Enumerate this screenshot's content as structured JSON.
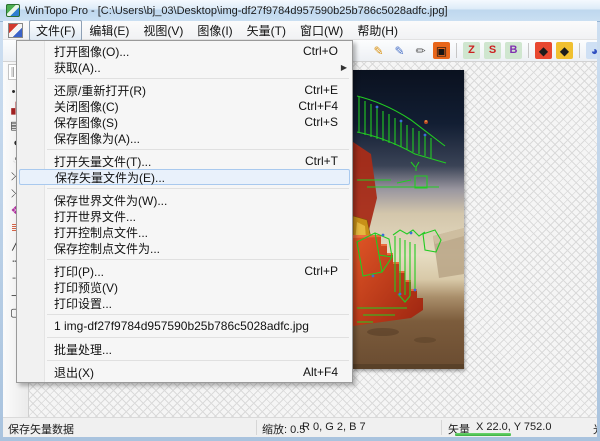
{
  "window": {
    "title": "WinTopo Pro - [C:\\Users\\bj_03\\Desktop\\img-df27f9784d957590b25b786c5028adfc.jpg]"
  },
  "colors": {
    "highlight_bg": "#e9f1fb",
    "highlight_border": "#a9c9ee",
    "vector_green": "#22cc22",
    "progress_green": "#3cb043",
    "stairs_red": "#c53a1c"
  },
  "menubar": {
    "items": [
      {
        "name": "file",
        "label": "文件(F)",
        "active": true
      },
      {
        "name": "edit",
        "label": "编辑(E)"
      },
      {
        "name": "view",
        "label": "视图(V)"
      },
      {
        "name": "image",
        "label": "图像(I)"
      },
      {
        "name": "vector",
        "label": "矢量(T)"
      },
      {
        "name": "window",
        "label": "窗口(W)"
      },
      {
        "name": "help",
        "label": "帮助(H)"
      }
    ]
  },
  "toolbar": {
    "items": [
      {
        "name": "pencil",
        "glyph": "✎",
        "fg": "#d89010"
      },
      {
        "name": "pencil-edit",
        "glyph": "✎",
        "fg": "#4a72c8"
      },
      {
        "name": "pencil-fill",
        "glyph": "✏",
        "fg": "#5a5a5a"
      },
      {
        "name": "crop",
        "glyph": "▣",
        "fg": "#151515",
        "bg": "#e8661a"
      },
      {
        "sep": true
      },
      {
        "name": "zoom-z",
        "glyph": "Z",
        "fg": "#cc2020",
        "bg": "#cfe6cf",
        "letter": true
      },
      {
        "name": "zoom-s",
        "glyph": "S",
        "fg": "#cc2020",
        "bg": "#cfe6cf",
        "letter": true
      },
      {
        "name": "zoom-b",
        "glyph": "B",
        "fg": "#8030b0",
        "bg": "#cfe6cf",
        "letter": true
      },
      {
        "sep": true
      },
      {
        "name": "vector-red-diamond",
        "glyph": "◆",
        "fg": "#1c1c1c",
        "bg": "#e84830"
      },
      {
        "name": "vector-yellow-diamond",
        "glyph": "◆",
        "fg": "#1c1c1c",
        "bg": "#f0c030"
      },
      {
        "sep": true
      },
      {
        "name": "one-touch-vectorize",
        "glyph": "◕",
        "fg": "#3050c0",
        "bg": "#cfe0f4"
      }
    ]
  },
  "left_toolbar": {
    "items": [
      {
        "name": "despeckle-dots-tool",
        "glyph": "••"
      },
      {
        "name": "speckle-pattern-tool",
        "glyph": "▞",
        "fg": "#a02020"
      },
      {
        "name": "stripes-tool",
        "glyph": "▤"
      },
      {
        "name": "half-circle-tool",
        "glyph": "◖"
      },
      {
        "name": "arc-dots-tool",
        "glyph": "◔"
      },
      {
        "name": "remove-line-tool",
        "glyph": "⤫"
      },
      {
        "name": "erase-line-tool",
        "glyph": "⤬"
      },
      {
        "name": "color-pinwheel-tool",
        "glyph": "❖",
        "fg": "#b030a0"
      },
      {
        "name": "color-bars-tool",
        "glyph": "≣",
        "fg": "#d05030"
      },
      {
        "name": "pen-line-tool",
        "glyph": "╱"
      },
      {
        "name": "dashed-line-tool",
        "glyph": "┄"
      },
      {
        "name": "dotted-line-tool",
        "glyph": "┈"
      },
      {
        "name": "solid-line-tool",
        "glyph": "─"
      },
      {
        "name": "rectangle-tool",
        "glyph": "▢"
      }
    ]
  },
  "file_menu": {
    "items": [
      {
        "name": "open-image",
        "label": "打开图像(O)...",
        "shortcut": "Ctrl+O"
      },
      {
        "name": "acquire",
        "label": "获取(A)..",
        "submenu": true
      },
      {
        "sep": true
      },
      {
        "name": "revert-reopen",
        "label": "还原/重新打开(R)",
        "shortcut": "Ctrl+E"
      },
      {
        "name": "close-image",
        "label": "关闭图像(C)",
        "shortcut": "Ctrl+F4"
      },
      {
        "name": "save-image",
        "label": "保存图像(S)",
        "shortcut": "Ctrl+S"
      },
      {
        "name": "save-image-as",
        "label": "保存图像为(A)..."
      },
      {
        "sep": true
      },
      {
        "name": "open-vector-file",
        "label": "打开矢量文件(T)...",
        "shortcut": "Ctrl+T"
      },
      {
        "name": "save-vector-file-as",
        "label": "保存矢量文件为(E)...",
        "highlighted": true
      },
      {
        "sep": true
      },
      {
        "name": "save-world-file-as",
        "label": "保存世界文件为(W)..."
      },
      {
        "name": "open-world-file",
        "label": "打开世界文件..."
      },
      {
        "name": "open-control-point-file",
        "label": "打开控制点文件..."
      },
      {
        "name": "save-control-point-file-as",
        "label": "保存控制点文件为..."
      },
      {
        "sep": true
      },
      {
        "name": "print",
        "label": "打印(P)...",
        "shortcut": "Ctrl+P"
      },
      {
        "name": "print-preview",
        "label": "打印预览(V)"
      },
      {
        "name": "print-setup",
        "label": "打印设置..."
      },
      {
        "sep": true
      },
      {
        "name": "recent-file-1",
        "label": "1 img-df27f9784d957590b25b786c5028adfc.jpg"
      },
      {
        "sep": true
      },
      {
        "name": "batch-process",
        "label": "批量处理..."
      },
      {
        "sep": true
      },
      {
        "name": "exit",
        "label": "退出(X)",
        "shortcut": "Alt+F4"
      }
    ]
  },
  "statusbar": {
    "message": "保存矢量数据",
    "zoom": "缩放: 0.5",
    "rgb": "R 0, G 2, B 7",
    "vector_label": "矢量",
    "vector_coords": "X 22.0, Y 752.0",
    "clipped": "光"
  }
}
